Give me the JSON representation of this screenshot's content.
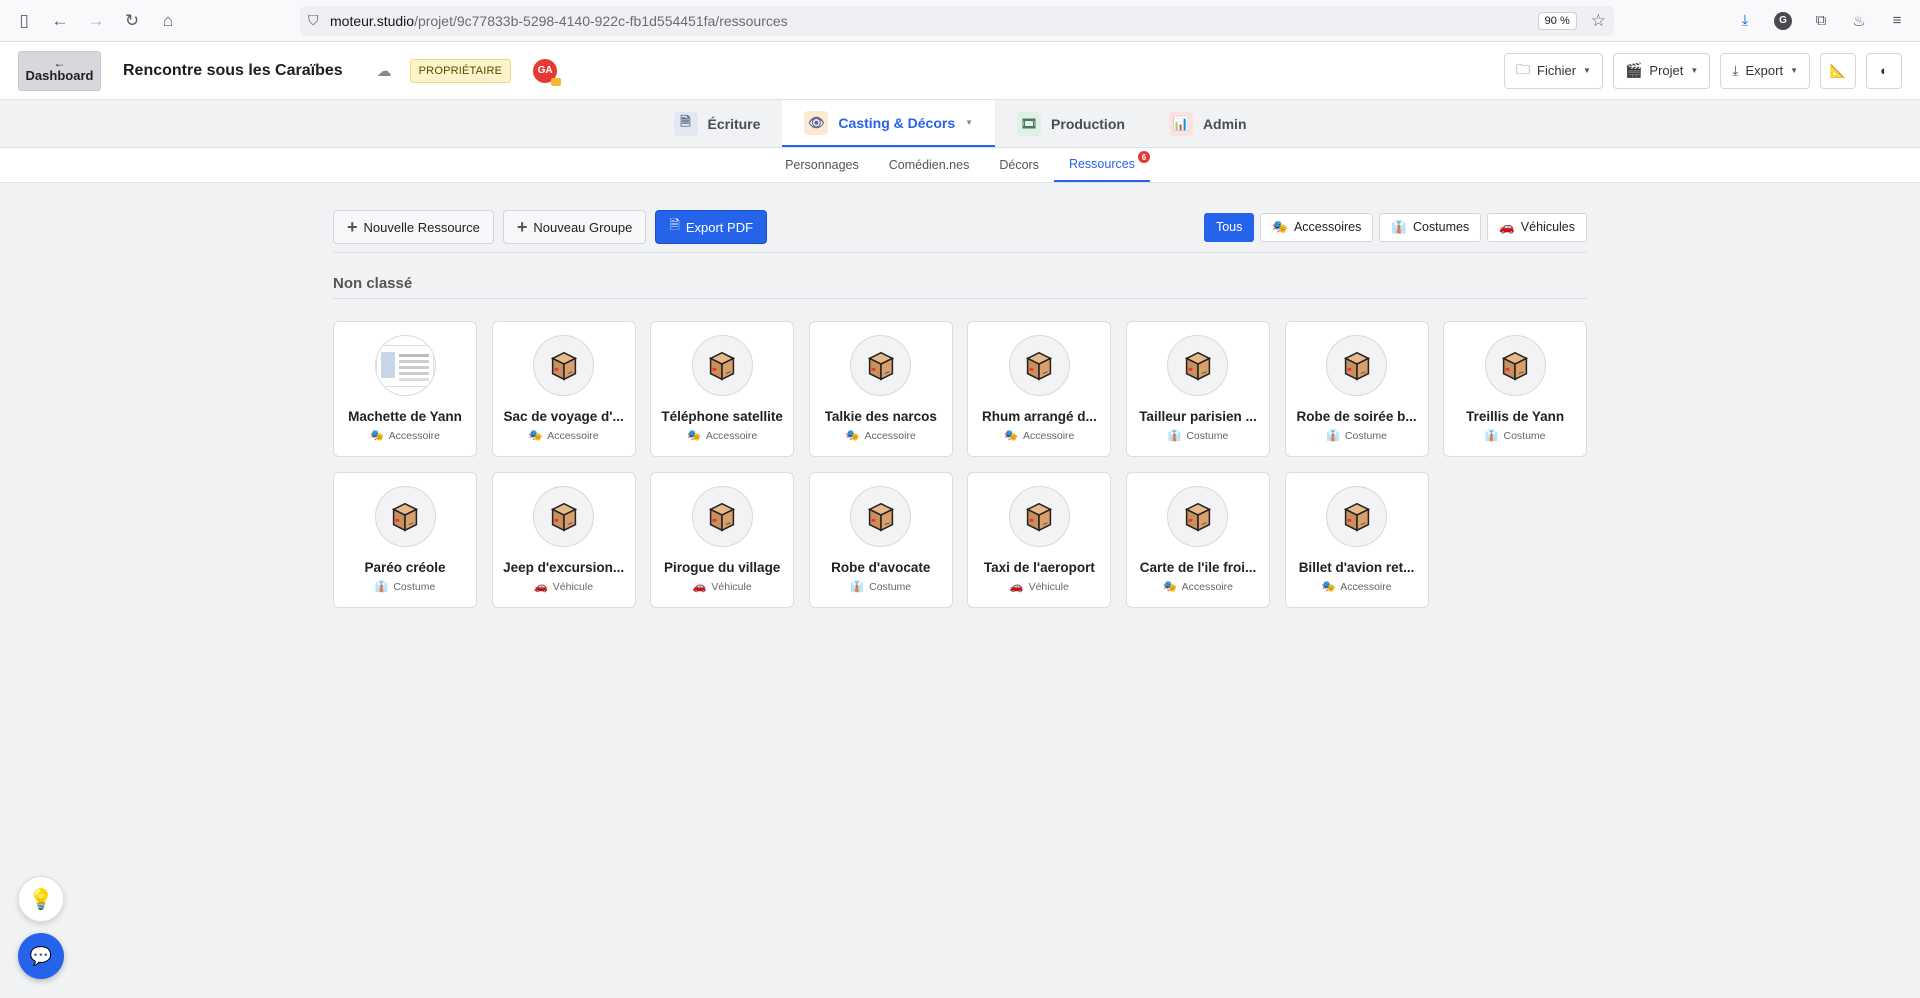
{
  "browser": {
    "url_host": "moteur.studio",
    "url_path": "/projet/9c77833b-5298-4140-922c-fb1d554451fa/ressources",
    "zoom": "90 %",
    "profile_initial": "G"
  },
  "header": {
    "dashboard_label": "Dashboard",
    "project_title": "Rencontre sous les Caraïbes",
    "owner_badge": "PROPRIÉTAIRE",
    "avatar_initials": "GA",
    "menus": [
      "Fichier",
      "Projet",
      "Export"
    ]
  },
  "main_tabs": [
    {
      "label": "Écriture",
      "icon": "document-icon",
      "active": false
    },
    {
      "label": "Casting & Décors",
      "icon": "eye-icon",
      "active": true
    },
    {
      "label": "Production",
      "icon": "clapper-icon",
      "active": false
    },
    {
      "label": "Admin",
      "icon": "chart-icon",
      "active": false
    }
  ],
  "sub_tabs": [
    {
      "label": "Personnages",
      "active": false
    },
    {
      "label": "Comédien.nes",
      "active": false
    },
    {
      "label": "Décors",
      "active": false
    },
    {
      "label": "Ressources",
      "active": true,
      "count": "6"
    }
  ],
  "toolbar": {
    "new_resource": "Nouvelle Ressource",
    "new_group": "Nouveau Groupe",
    "export_pdf": "Export PDF"
  },
  "filters": [
    {
      "label": "Tous",
      "icon": "",
      "active": true
    },
    {
      "label": "Accessoires",
      "icon": "🎭",
      "active": false
    },
    {
      "label": "Costumes",
      "icon": "👔",
      "active": false
    },
    {
      "label": "Véhicules",
      "icon": "🚗",
      "active": false
    }
  ],
  "group": {
    "title": "Non classé",
    "items": [
      {
        "name": "Machette de Yann",
        "type": "Accessoire",
        "icon": "🎭",
        "photo": true
      },
      {
        "name": "Sac de voyage d'...",
        "type": "Accessoire",
        "icon": "🎭"
      },
      {
        "name": "Téléphone satellite",
        "type": "Accessoire",
        "icon": "🎭"
      },
      {
        "name": "Talkie des narcos",
        "type": "Accessoire",
        "icon": "🎭"
      },
      {
        "name": "Rhum arrangé d...",
        "type": "Accessoire",
        "icon": "🎭"
      },
      {
        "name": "Tailleur parisien ...",
        "type": "Costume",
        "icon": "👔"
      },
      {
        "name": "Robe de soirée b...",
        "type": "Costume",
        "icon": "👔"
      },
      {
        "name": "Treillis de Yann",
        "type": "Costume",
        "icon": "👔"
      },
      {
        "name": "Paréo créole",
        "type": "Costume",
        "icon": "👔"
      },
      {
        "name": "Jeep d'excursion...",
        "type": "Véhicule",
        "icon": "🚗"
      },
      {
        "name": "Pirogue du village",
        "type": "Véhicule",
        "icon": "🚗"
      },
      {
        "name": "Robe d'avocate",
        "type": "Costume",
        "icon": "👔"
      },
      {
        "name": "Taxi de l'aeroport",
        "type": "Véhicule",
        "icon": "🚗"
      },
      {
        "name": "Carte de l'ile froi...",
        "type": "Accessoire",
        "icon": "🎭"
      },
      {
        "name": "Billet d'avion ret...",
        "type": "Accessoire",
        "icon": "🎭"
      }
    ]
  }
}
